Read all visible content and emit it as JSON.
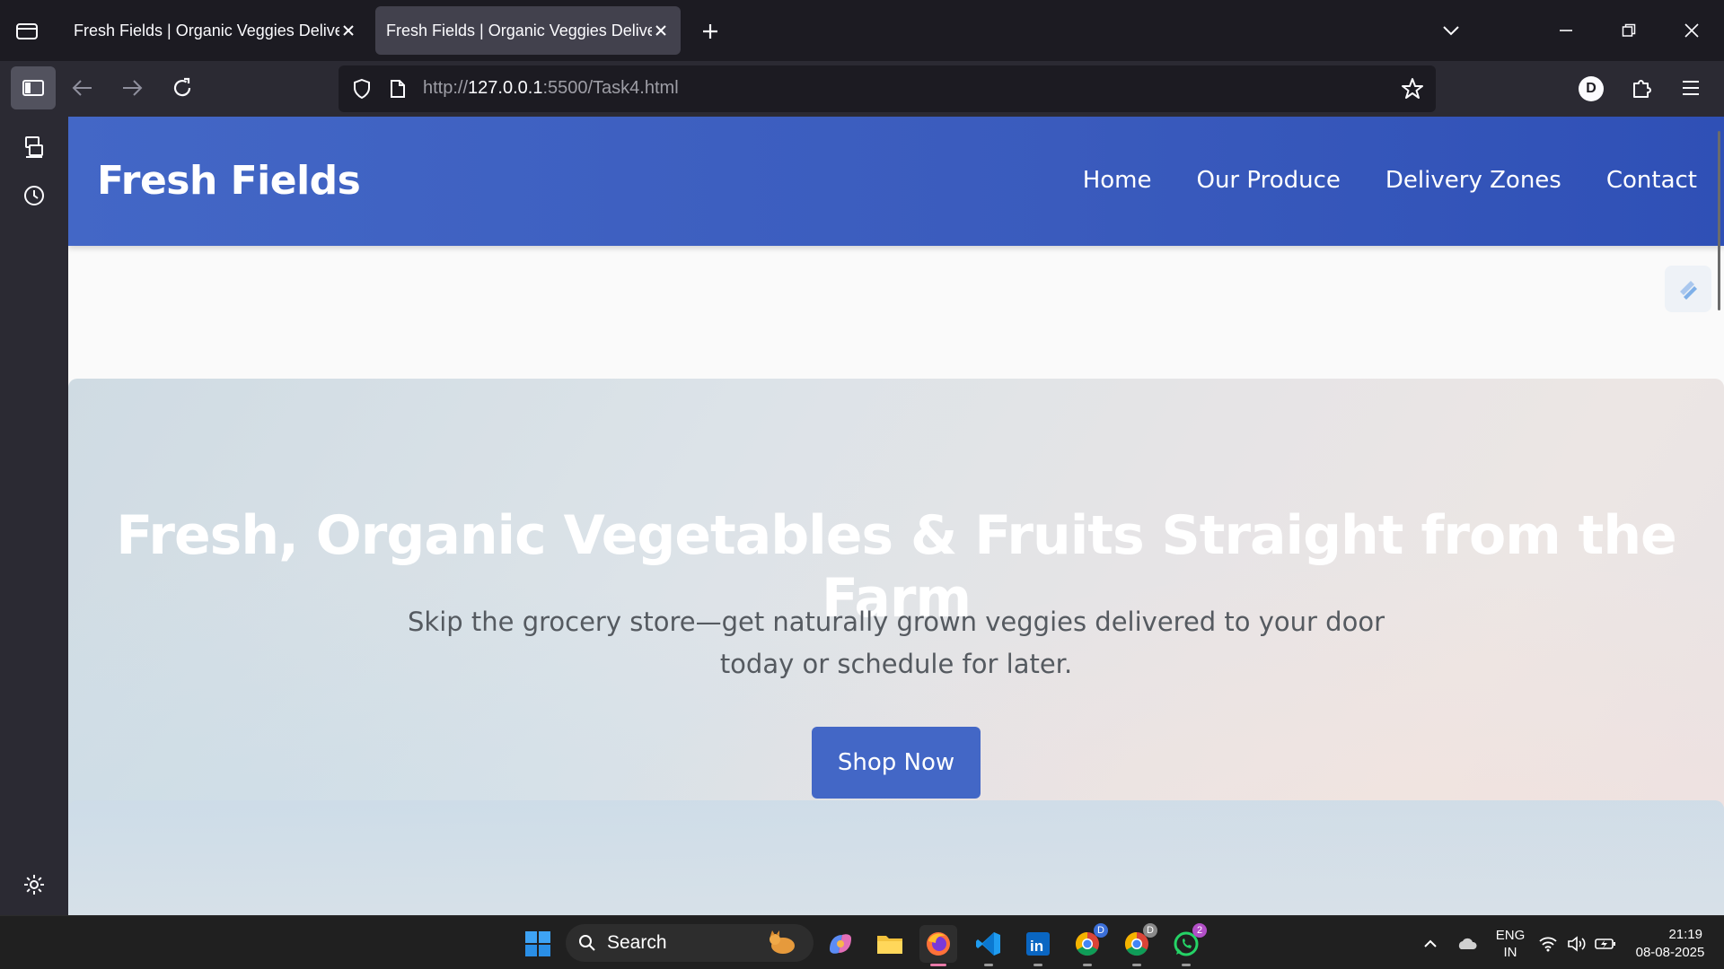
{
  "browser": {
    "tabs": [
      {
        "title": "Fresh Fields | Organic Veggies Delivered"
      },
      {
        "title": "Fresh Fields | Organic Veggies Delivered"
      }
    ],
    "url": {
      "scheme": "http://",
      "host": "127.0.0.1",
      "rest": ":5500/Task4.html"
    },
    "profile_initial": "D",
    "colors": {
      "chrome_dark": "#1c1b22",
      "toolbar": "#2b2a33",
      "active_tab": "#42414d"
    }
  },
  "site": {
    "logo": "Fresh Fields",
    "nav": [
      "Home",
      "Our Produce",
      "Delivery Zones",
      "Contact"
    ],
    "hero": {
      "title": "Fresh, Organic Vegetables & Fruits Straight from the Farm",
      "subtitle": "Skip the grocery store—get naturally grown veggies delivered to your door today or schedule for later.",
      "cta": "Shop Now"
    },
    "colors": {
      "primary": "#4367c6",
      "hero_text": "#ffffff",
      "subtitle_text": "#555a60"
    }
  },
  "taskbar": {
    "search_label": "Search",
    "language": {
      "line1": "ENG",
      "line2": "IN"
    },
    "time": "21:19",
    "date": "08-08-2025",
    "badges": {
      "chrome1": "D",
      "chrome2": "D",
      "whatsapp": "2"
    },
    "icons": [
      "windows-start-icon",
      "copilot-icon",
      "file-explorer-icon",
      "firefox-icon",
      "vscode-icon",
      "linkedin-icon",
      "chrome-icon",
      "chrome-icon",
      "whatsapp-icon"
    ]
  }
}
